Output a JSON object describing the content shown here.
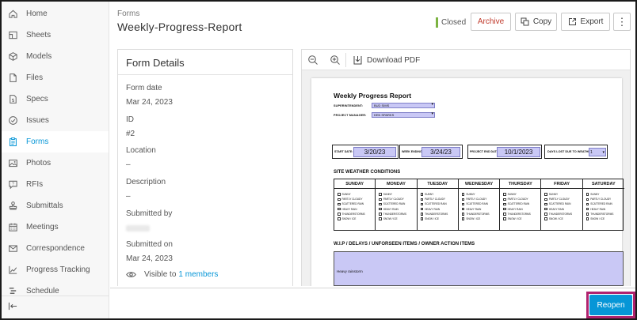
{
  "sidebar": {
    "items": [
      {
        "label": "Home",
        "icon": "home-icon"
      },
      {
        "label": "Sheets",
        "icon": "sheets-icon"
      },
      {
        "label": "Models",
        "icon": "cube-icon"
      },
      {
        "label": "Files",
        "icon": "file-icon"
      },
      {
        "label": "Specs",
        "icon": "specs-icon"
      },
      {
        "label": "Issues",
        "icon": "check-circle-icon"
      },
      {
        "label": "Forms",
        "icon": "clipboard-icon",
        "active": true
      },
      {
        "label": "Photos",
        "icon": "photo-icon"
      },
      {
        "label": "RFIs",
        "icon": "rfi-icon"
      },
      {
        "label": "Submittals",
        "icon": "stamp-icon"
      },
      {
        "label": "Meetings",
        "icon": "calendar-icon"
      },
      {
        "label": "Correspondence",
        "icon": "envelope-icon"
      },
      {
        "label": "Progress Tracking",
        "icon": "chart-line-icon"
      },
      {
        "label": "Schedule",
        "icon": "schedule-icon"
      }
    ],
    "collapse_icon": "collapse-left-icon"
  },
  "header": {
    "breadcrumb": "Forms",
    "title": "Weekly-Progress-Report",
    "status": "Closed",
    "status_color": "#7cb342",
    "archive_label": "Archive",
    "copy_label": "Copy",
    "export_label": "Export",
    "more_label": "⋮"
  },
  "details": {
    "title": "Form Details",
    "form_date_label": "Form date",
    "form_date_value": "Mar 24, 2023",
    "id_label": "ID",
    "id_value": "#2",
    "location_label": "Location",
    "location_value": "–",
    "description_label": "Description",
    "description_value": "–",
    "submitted_by_label": "Submitted by",
    "submitted_on_label": "Submitted on",
    "submitted_on_value": "Mar 24, 2023",
    "visible_prefix": "Visible to",
    "visible_link": "1 members"
  },
  "viewer": {
    "download_label": "Download PDF"
  },
  "report": {
    "title": "Weekly Progress Report",
    "superintendent_label": "SUPERINTENDENT:",
    "superintendent_value": "BUD SIMS",
    "project_manager_label": "PROJECT MANAGER:",
    "project_manager_value": "KEN SPARKS",
    "start_date_label": "START DATE:",
    "start_date_value": "3/20/23",
    "week_ending_label": "WEEK ENDING:",
    "week_ending_value": "3/24/23",
    "project_end_label": "PROJECT END DATE:",
    "project_end_value": "10/1/2023",
    "days_lost_label": "DAYS LOST DUE TO WEATHER:",
    "days_lost_value": "1",
    "weather_title": "SITE WEATHER CONDITIONS",
    "days": [
      "SUNDAY",
      "MONDAY",
      "TUESDAY",
      "WEDNESDAY",
      "THURSDAY",
      "FRIDAY",
      "SATURDAY"
    ],
    "weather_options": [
      "SUNNY",
      "PARTLY CLOUDY",
      "SCATTERED RAIN",
      "HEAVY RAIN",
      "THUNDERSTORMS",
      "SNOW / ICE"
    ],
    "wip_title": "W.I.P / DELAYS / UNFORSEEN ITEMS / OWNER ACTION ITEMS",
    "wip_value": "Heavy rainstorm"
  },
  "footer": {
    "reopen_label": "Reopen",
    "highlight_color": "#b0226e"
  }
}
